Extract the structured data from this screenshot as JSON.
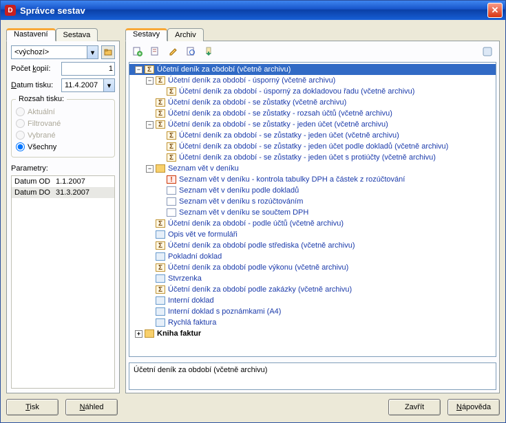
{
  "window": {
    "title": "Správce sestav",
    "close_label": "✕",
    "app_icon_letter": "D"
  },
  "left": {
    "tabs": [
      "Nastavení",
      "Sestava"
    ],
    "active_tab": 0,
    "combo_value": "<výchozí>",
    "browse_tip": "…",
    "copies_label_pre": "Počet ",
    "copies_label_u": "k",
    "copies_label_post": "opií:",
    "copies_value": "1",
    "date_label_pre": "",
    "date_label_u": "D",
    "date_label_post": "atum tisku:",
    "date_value": "11.4.2007",
    "fieldset_title": "Rozsah tisku:",
    "radios": [
      {
        "label": "Aktuální",
        "enabled": false,
        "checked": false
      },
      {
        "label": "Filtrované",
        "enabled": false,
        "checked": false
      },
      {
        "label": "Vybrané",
        "enabled": false,
        "checked": false
      },
      {
        "label": "Všechny",
        "enabled": true,
        "checked": true
      }
    ],
    "params_label": "Parametry:",
    "params": [
      {
        "k": "Datum OD",
        "v": "1.1.2007",
        "sel": false
      },
      {
        "k": "Datum DO",
        "v": "31.3.2007",
        "sel": true
      }
    ]
  },
  "right": {
    "tabs": [
      "Sestavy",
      "Archiv"
    ],
    "active_tab": 0,
    "toolbar_icons": [
      "add-icon",
      "props-icon",
      "edit-icon",
      "preview-icon",
      "export-icon",
      "help-small-icon"
    ],
    "tree": [
      {
        "depth": 0,
        "toggle": "-",
        "icon": "sigma",
        "label": "Účetní deník za období (včetně archivu)",
        "selected": true
      },
      {
        "depth": 1,
        "toggle": "-",
        "icon": "sigma",
        "label": "Účetní deník za období - úsporný (včetně archivu)"
      },
      {
        "depth": 2,
        "toggle": "",
        "icon": "sigma",
        "label": "Účetní deník za období - úsporný za dokladovou řadu (včetně archivu)"
      },
      {
        "depth": 1,
        "toggle": "",
        "icon": "sigma",
        "label": "Účetní deník za období - se zůstatky (včetně archivu)"
      },
      {
        "depth": 1,
        "toggle": "",
        "icon": "sigma",
        "label": "Účetní deník za období - se zůstatky - rozsah účtů (včetně archivu)"
      },
      {
        "depth": 1,
        "toggle": "-",
        "icon": "sigma",
        "label": "Účetní deník za období - se zůstatky - jeden účet (včetně archivu)"
      },
      {
        "depth": 2,
        "toggle": "",
        "icon": "sigma",
        "label": "Účetní deník za období - se zůstatky - jeden účet (včetně archivu)"
      },
      {
        "depth": 2,
        "toggle": "",
        "icon": "sigma",
        "label": "Účetní deník za období - se zůstatky - jeden účet podle dokladů (včetně archivu)"
      },
      {
        "depth": 2,
        "toggle": "",
        "icon": "sigma",
        "label": "Účetní deník za období - se zůstatky - jeden účet s protiúčty (včetně archivu)"
      },
      {
        "depth": 1,
        "toggle": "-",
        "icon": "folder",
        "label": "Seznam vět v deníku"
      },
      {
        "depth": 2,
        "toggle": "",
        "icon": "excl",
        "label": "Seznam vět v deníku - kontrola tabulky DPH a částek z rozúčtování"
      },
      {
        "depth": 2,
        "toggle": "",
        "icon": "page",
        "label": "Seznam vět v deníku podle dokladů"
      },
      {
        "depth": 2,
        "toggle": "",
        "icon": "page",
        "label": "Seznam vět v deníku s rozúčtováním"
      },
      {
        "depth": 2,
        "toggle": "",
        "icon": "page",
        "label": "Seznam vět v deníku se součtem DPH"
      },
      {
        "depth": 1,
        "toggle": "",
        "icon": "sigma",
        "label": "Účetní deník za období - podle účtů (včetně archivu)"
      },
      {
        "depth": 1,
        "toggle": "",
        "icon": "form",
        "label": "Opis vět ve formuláři"
      },
      {
        "depth": 1,
        "toggle": "",
        "icon": "sigma",
        "label": "Účetní deník za období podle střediska (včetně archivu)"
      },
      {
        "depth": 1,
        "toggle": "",
        "icon": "form",
        "label": "Pokladní doklad"
      },
      {
        "depth": 1,
        "toggle": "",
        "icon": "sigma",
        "label": "Účetní deník za období podle výkonu (včetně archivu)"
      },
      {
        "depth": 1,
        "toggle": "",
        "icon": "form",
        "label": "Stvrzenka"
      },
      {
        "depth": 1,
        "toggle": "",
        "icon": "sigma",
        "label": "Účetní deník za období podle zakázky (včetně archivu)"
      },
      {
        "depth": 1,
        "toggle": "",
        "icon": "form",
        "label": "Interní doklad"
      },
      {
        "depth": 1,
        "toggle": "",
        "icon": "form",
        "label": "Interní doklad s poznámkami (A4)"
      },
      {
        "depth": 1,
        "toggle": "",
        "icon": "form",
        "label": "Rychlá faktura"
      },
      {
        "depth": 0,
        "toggle": "+",
        "icon": "folder",
        "label": "Kniha faktur",
        "bold": true
      }
    ],
    "status": "Účetní deník za období (včetně archivu)"
  },
  "buttons": {
    "print_u": "T",
    "print_post": "isk",
    "preview_u": "N",
    "preview_post": "áhled",
    "close": "Zavřít",
    "help_u": "N",
    "help_post": "ápověda"
  }
}
